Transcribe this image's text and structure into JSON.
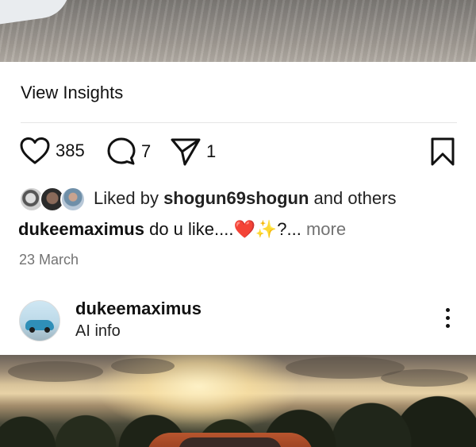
{
  "post_top": {
    "insights_label": "View Insights",
    "actions": {
      "like_count": "385",
      "comment_count": "7",
      "share_count": "1"
    },
    "liked_by": {
      "prefix": "Liked by ",
      "user": "shogun69shogun",
      "suffix": " and others"
    },
    "caption": {
      "username": "dukeemaximus",
      "text": " do u like....❤️✨?... ",
      "more": "more"
    },
    "date": "23 March"
  },
  "post_next": {
    "username": "dukeemaximus",
    "subtitle": "AI info"
  }
}
